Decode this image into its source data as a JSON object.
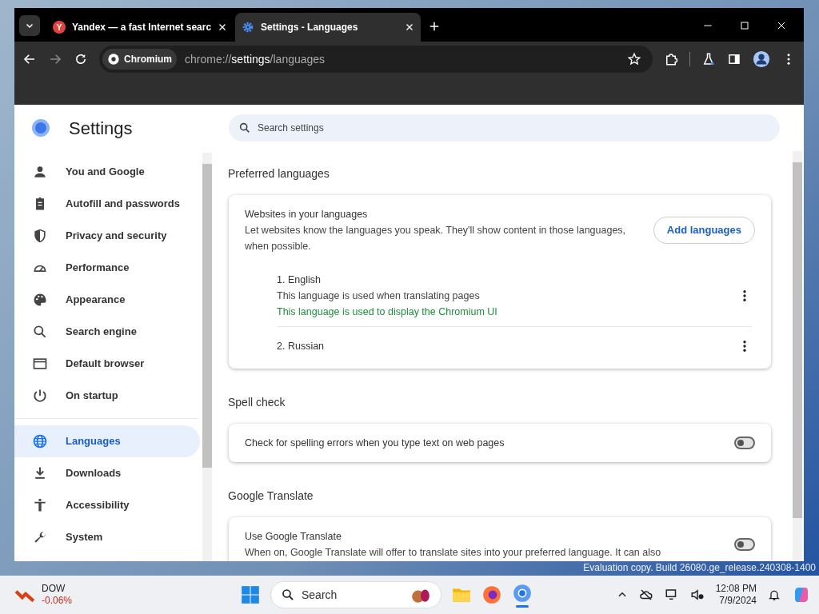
{
  "browser": {
    "tabs": [
      {
        "title": "Yandex — a fast Internet searc",
        "selected": false,
        "kind": "website",
        "icon_text": "Y"
      },
      {
        "title": "Settings - Languages",
        "selected": true,
        "kind": "settings"
      }
    ],
    "address": {
      "chip": "Chromium",
      "scheme": "chrome://",
      "host": "settings",
      "path": "/languages"
    }
  },
  "settings": {
    "title": "Settings",
    "search_placeholder": "Search settings",
    "sidebar": [
      {
        "label": "You and Google",
        "selected": false
      },
      {
        "label": "Autofill and passwords",
        "selected": false
      },
      {
        "label": "Privacy and security",
        "selected": false
      },
      {
        "label": "Performance",
        "selected": false
      },
      {
        "label": "Appearance",
        "selected": false
      },
      {
        "label": "Search engine",
        "selected": false
      },
      {
        "label": "Default browser",
        "selected": false
      },
      {
        "label": "On startup",
        "selected": false
      },
      {
        "label": "Languages",
        "selected": true
      },
      {
        "label": "Downloads",
        "selected": false
      },
      {
        "label": "Accessibility",
        "selected": false
      },
      {
        "label": "System",
        "selected": false
      }
    ],
    "sections": [
      {
        "kind": "languages",
        "heading": "Preferred languages",
        "title": "Websites in your languages",
        "description": "Let websites know the languages you speak. They'll show content in those languages, when possible.",
        "button": "Add languages",
        "languages": [
          {
            "name": "1. English",
            "notes": [
              "This language is used when translating pages"
            ],
            "ui_note": "This language is used to display the Chromium UI"
          },
          {
            "name": "2. Russian"
          }
        ]
      },
      {
        "kind": "toggle",
        "heading": "Spell check",
        "title": "Check for spelling errors when you type text on web pages",
        "on": false
      },
      {
        "kind": "toggle",
        "heading": "Google Translate",
        "title": "Use Google Translate",
        "description": "When on, Google Translate will offer to translate sites into your preferred language. It can also",
        "on": false
      }
    ]
  },
  "desktop": {
    "watermark": "Evaluation copy. Build 26080.ge_release.240308-1400"
  },
  "taskbar": {
    "ticker": {
      "name": "DOW",
      "change": "-0.06%"
    },
    "search_placeholder": "Search",
    "time": "12:08 PM",
    "date": "7/9/2024"
  }
}
